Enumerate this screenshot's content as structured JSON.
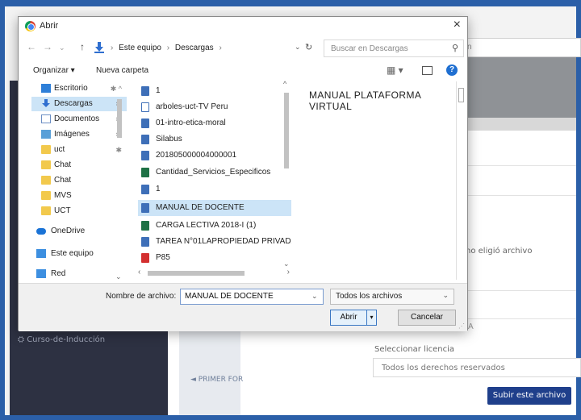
{
  "background_page": {
    "search_partial": "n",
    "no_file_text": "no eligió archivo",
    "sidebar_item": "Curso-de-Inducción",
    "license_label": "Seleccionar licencia",
    "license_value": "Todos los derechos reservados",
    "upload_button": "Subir este archivo",
    "prev_link": "◄ PRIMER FOR",
    "field_mark": "A"
  },
  "dialog": {
    "title": "Abrir",
    "close": "×",
    "breadcrumb": [
      "Este equipo",
      "Descargas"
    ],
    "search_placeholder": "Buscar en Descargas",
    "toolbar": {
      "organize": "Organizar ▾",
      "new_folder": "Nueva carpeta",
      "help": "?"
    },
    "nav_items": [
      {
        "label": "Escritorio",
        "icon": "desktop-icon",
        "pinned": true
      },
      {
        "label": "Descargas",
        "icon": "download-icon",
        "pinned": true,
        "selected": true
      },
      {
        "label": "Documentos",
        "icon": "document-icon",
        "pinned": true
      },
      {
        "label": "Imágenes",
        "icon": "image-icon",
        "pinned": true
      },
      {
        "label": "uct",
        "icon": "folder-icon",
        "pinned": true
      },
      {
        "label": "Chat",
        "icon": "folder-icon"
      },
      {
        "label": "Chat",
        "icon": "folder-icon"
      },
      {
        "label": "MVS",
        "icon": "folder-icon"
      },
      {
        "label": "UCT",
        "icon": "folder-icon"
      },
      {
        "label": "OneDrive",
        "icon": "cloud-icon"
      },
      {
        "label": "Este equipo",
        "icon": "computer-icon"
      },
      {
        "label": "Red",
        "icon": "network-icon"
      }
    ],
    "files": [
      {
        "name": "1",
        "type": "img"
      },
      {
        "name": "arboles-uct-TV Peru",
        "type": "doc"
      },
      {
        "name": "01-intro-etica-moral",
        "type": "img"
      },
      {
        "name": "Silabus",
        "type": "word"
      },
      {
        "name": "201805000004000001",
        "type": "word"
      },
      {
        "name": "Cantidad_Servicios_Especificos",
        "type": "xls"
      },
      {
        "name": "1",
        "type": "img"
      },
      {
        "name": "MANUAL DE DOCENTE",
        "type": "word",
        "selected": true
      },
      {
        "name": "CARGA LECTIVA 2018-I (1)",
        "type": "xls"
      },
      {
        "name": "TAREA N°01LAPROPIEDAD PRIVADA",
        "type": "word"
      },
      {
        "name": "P85",
        "type": "pdf"
      }
    ],
    "preview_text": "MANUAL   PLATAFORMA VIRTUAL",
    "filename_label": "Nombre de archivo:",
    "filename_value": "MANUAL DE DOCENTE",
    "filetype_value": "Todos los archivos",
    "open_button": "Abrir",
    "cancel_button": "Cancelar"
  }
}
